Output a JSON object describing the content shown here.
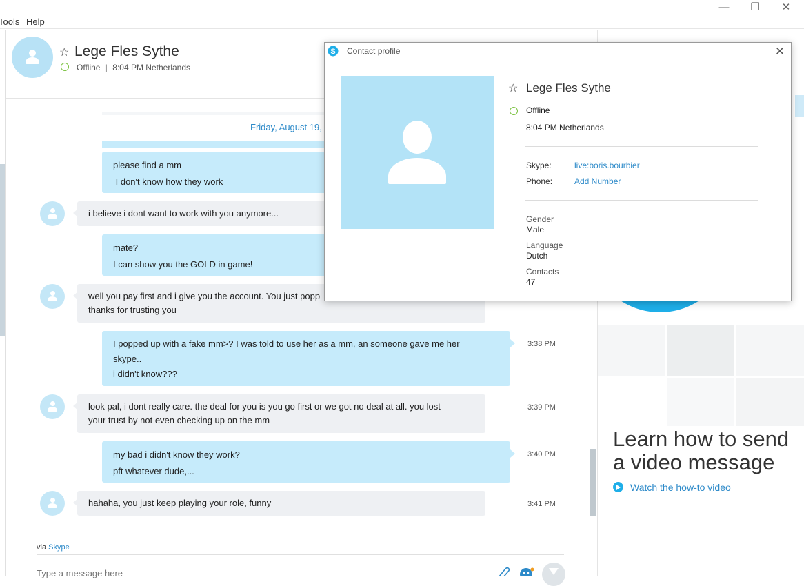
{
  "menu": {
    "items": [
      "Tools",
      "Help"
    ]
  },
  "window": {
    "minimize": "—",
    "restore": "❐",
    "close": "✕"
  },
  "header": {
    "name": "Lege Fles Sythe",
    "status": "Offline",
    "local_time": "8:04 PM Netherlands"
  },
  "conversation": {
    "date": "Friday, August 19,",
    "messages": [
      {
        "dir": "out",
        "lines": [
          "please find a mm",
          " I don't know how they work"
        ],
        "time": ""
      },
      {
        "dir": "in",
        "lines": [
          "i believe i dont want to work with you anymore..."
        ],
        "time": ""
      },
      {
        "dir": "out",
        "lines": [
          "mate?",
          "I can show you the GOLD in game!"
        ],
        "time": ""
      },
      {
        "dir": "in",
        "lines": [
          "well you pay first and i give you the account. You just popp",
          "thanks for trusting you"
        ],
        "time": ""
      },
      {
        "dir": "out",
        "lines": [
          "I popped up with a fake mm>? I was told to use her as a mm, an someone gave me her",
          "skype..",
          "i didn't know???"
        ],
        "time": "3:38 PM"
      },
      {
        "dir": "in",
        "lines": [
          "look pal, i dont really care. the deal for you is you go first or we got no deal at all. you lost",
          "your trust by not even checking up on the mm"
        ],
        "time": "3:39 PM"
      },
      {
        "dir": "out",
        "lines": [
          "my bad i didn't know they work?",
          "pft whatever dude,..."
        ],
        "time": "3:40 PM"
      },
      {
        "dir": "in",
        "lines": [
          "hahaha, you just keep playing your role, funny"
        ],
        "time": "3:41 PM"
      }
    ]
  },
  "footer": {
    "via_prefix": "via",
    "via_link": "Skype",
    "compose_placeholder": "Type a message here"
  },
  "promo": {
    "title": "Learn how to send a video message",
    "link": "Watch the how-to video"
  },
  "profile": {
    "dialog_title": "Contact profile",
    "close": "✕",
    "name": "Lege Fles Sythe",
    "status": "Offline",
    "local_time": "8:04 PM Netherlands",
    "skype_label": "Skype:",
    "skype_value": "live:boris.bourbier",
    "phone_label": "Phone:",
    "phone_value": "Add Number",
    "gender_label": "Gender",
    "gender_value": "Male",
    "language_label": "Language",
    "language_value": "Dutch",
    "contacts_label": "Contacts",
    "contacts_value": "47"
  },
  "colors": {
    "accent": "#2d8ac9",
    "bubble_out": "#c6ebfb",
    "bubble_in": "#eef0f3",
    "presence_offline": "#7cc242",
    "skype_blue": "#1eaee8"
  }
}
